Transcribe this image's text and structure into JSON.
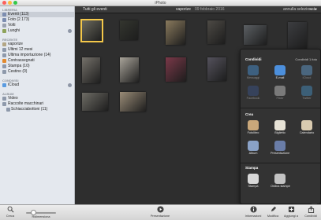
{
  "window": {
    "title": "iPhoto"
  },
  "sidebar": {
    "sections": [
      {
        "heading": "LIBRERIA",
        "items": [
          {
            "label": "Eventi (113)",
            "icon": "events-icon",
            "color": "#7c8db0",
            "selected": true
          },
          {
            "label": "Foto (2.173)",
            "icon": "photos-icon",
            "color": "#7c8db0"
          },
          {
            "label": "Volti",
            "icon": "faces-icon",
            "color": "#9aa2b0"
          },
          {
            "label": "Luoghi",
            "icon": "places-icon",
            "color": "#8ea35a",
            "badge": true
          }
        ]
      },
      {
        "heading": "RECENTE",
        "items": [
          {
            "label": "vaporize",
            "icon": "event-icon",
            "color": "#b3a684"
          },
          {
            "label": "Ultimi 12 mesi",
            "icon": "calendar-icon",
            "color": "#8e99ab"
          },
          {
            "label": "Ultima importazione (14)",
            "icon": "import-icon",
            "color": "#8e99ab"
          },
          {
            "label": "Contrassegnati",
            "icon": "flag-icon",
            "color": "#e28a2e"
          },
          {
            "label": "Stampa (10)",
            "icon": "print-icon",
            "color": "#8e99ab"
          },
          {
            "label": "Cestino (0)",
            "icon": "trash-icon",
            "color": "#8e99ab"
          }
        ]
      },
      {
        "heading": "CONDIVISI",
        "items": [
          {
            "label": "iCloud",
            "icon": "icloud-icon",
            "color": "#5a9be0",
            "badge": true
          }
        ]
      },
      {
        "heading": "ALBUM",
        "items": [
          {
            "label": "Video",
            "icon": "video-icon",
            "color": "#8e99ab"
          },
          {
            "label": "Raccolte macchinari",
            "icon": "folder-icon",
            "color": "#8e99ab"
          },
          {
            "label": "Schiacciabottoni (11)",
            "icon": "album-icon",
            "color": "#8e99ab",
            "indent": true
          }
        ]
      }
    ]
  },
  "topbar": {
    "events_label": "Tutti gli eventi",
    "current_event": "vaporize",
    "date": "09 febbraio 2016",
    "share_all": "annulla selezionate",
    "prev": "◂",
    "next": "▸"
  },
  "grid": {
    "thumbs": [
      {
        "color": "#6b6a5e",
        "selected": true
      },
      {
        "color": "#34362f"
      },
      {
        "color": "#8a7a5d"
      },
      {
        "color": "#4d4a45"
      },
      {
        "color": "#5b5f63"
      },
      {
        "color": "#3c3d40"
      },
      {
        "color": "#75716a"
      },
      {
        "color": "#a9a49a"
      },
      {
        "color": "#7a3848"
      },
      {
        "color": "#54525c"
      },
      {
        "color": "#8b8579"
      },
      {
        "color": "#6e6c65"
      },
      {
        "color": "#9a8c77"
      }
    ]
  },
  "popover": {
    "share_heading": "Condividi",
    "share_sub": "Condividi 1 foto",
    "share_items": [
      {
        "label": "Messaggi",
        "icon": "messages-icon",
        "color": "#4da4f5",
        "disabled": true
      },
      {
        "label": "E-mail",
        "icon": "email-icon",
        "color": "#4c8fdc"
      },
      {
        "label": "iCloud",
        "icon": "icloud-share-icon",
        "color": "#6fb3ef",
        "disabled": true
      },
      {
        "label": "Facebook",
        "icon": "facebook-icon",
        "color": "#3b5998",
        "disabled": true
      },
      {
        "label": "Flickr",
        "icon": "flickr-icon",
        "color": "#e5e5e5",
        "disabled": true
      },
      {
        "label": "Twitter",
        "icon": "twitter-icon",
        "color": "#4aa3df",
        "disabled": true
      }
    ],
    "create_heading": "Crea",
    "create_items": [
      {
        "label": "Fotolibro",
        "icon": "photobook-icon",
        "color": "#c9a77a"
      },
      {
        "label": "Biglietto",
        "icon": "card-icon",
        "color": "#e7e2d6"
      },
      {
        "label": "Calendario",
        "icon": "calendar-create-icon",
        "color": "#d9cbb0"
      },
      {
        "label": "Album",
        "icon": "album-create-icon",
        "color": "#8aa2c7"
      },
      {
        "label": "Presentazione",
        "icon": "slideshow-icon",
        "color": "#6a7da8"
      }
    ],
    "print_heading": "Stampa",
    "print_items": [
      {
        "label": "Stampa",
        "icon": "printer-icon",
        "color": "#d8d8d8"
      },
      {
        "label": "Ordina stampe",
        "icon": "order-prints-icon",
        "color": "#c3c3c3"
      }
    ]
  },
  "bottombar": {
    "search_label": "Cerca",
    "zoom_label": "Ridimensiona",
    "zoom_level": 0.25,
    "slideshow_label": "Presentazione",
    "info_label": "Informazioni",
    "edit_label": "Modifica",
    "add_label": "Aggiungi a",
    "share_label": "Condividi"
  }
}
